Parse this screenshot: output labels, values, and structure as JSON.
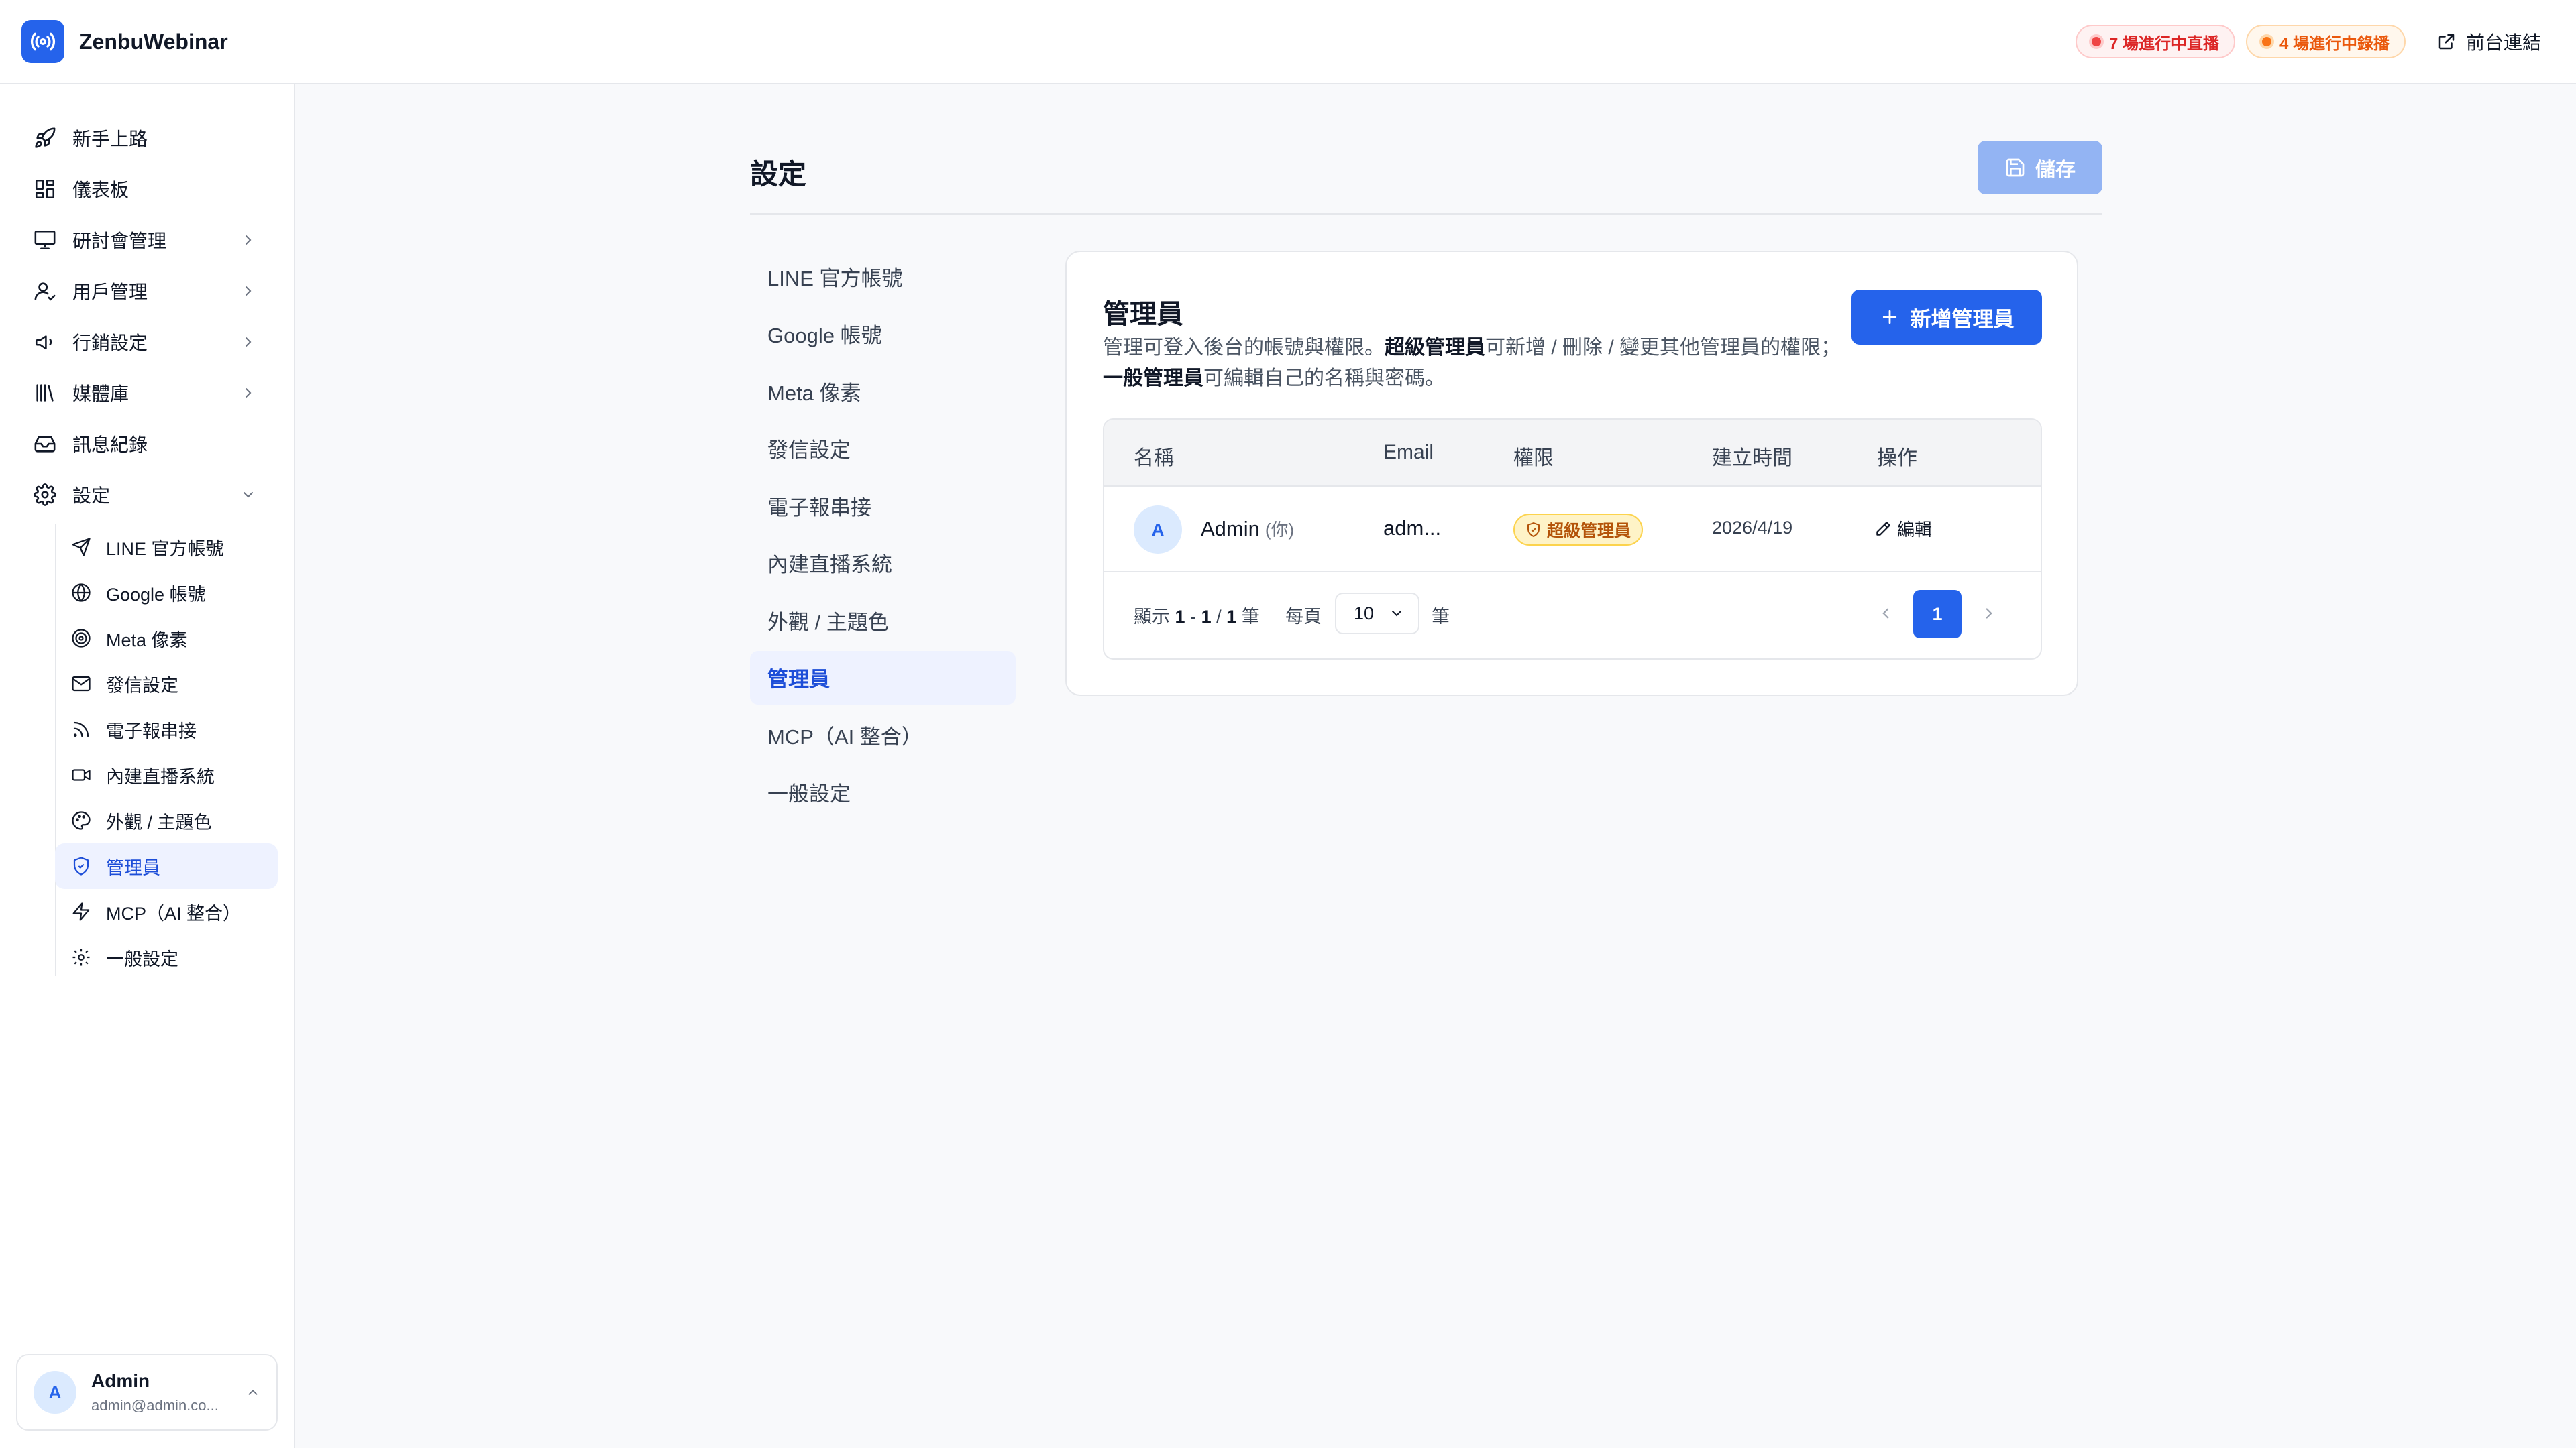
{
  "header": {
    "app_name": "ZenbuWebinar",
    "live_badge": "7 場進行中直播",
    "recording_badge": "4 場進行中錄播",
    "front_link": "前台連結"
  },
  "sidebar": {
    "items": [
      {
        "label": "新手上路",
        "icon": "rocket-icon"
      },
      {
        "label": "儀表板",
        "icon": "dashboard-icon"
      },
      {
        "label": "研討會管理",
        "icon": "presentation-icon"
      },
      {
        "label": "用戶管理",
        "icon": "users-icon"
      },
      {
        "label": "行銷設定",
        "icon": "megaphone-icon"
      },
      {
        "label": "媒體庫",
        "icon": "library-icon"
      },
      {
        "label": "訊息紀錄",
        "icon": "inbox-icon"
      },
      {
        "label": "設定",
        "icon": "gear-icon"
      }
    ],
    "sub_items": [
      {
        "label": "LINE 官方帳號",
        "icon": "send-icon"
      },
      {
        "label": "Google 帳號",
        "icon": "globe-icon"
      },
      {
        "label": "Meta 像素",
        "icon": "target-icon"
      },
      {
        "label": "發信設定",
        "icon": "mail-icon"
      },
      {
        "label": "電子報串接",
        "icon": "rss-icon"
      },
      {
        "label": "內建直播系統",
        "icon": "video-icon"
      },
      {
        "label": "外觀 / 主題色",
        "icon": "palette-icon"
      },
      {
        "label": "管理員",
        "icon": "shield-icon"
      },
      {
        "label": "MCP（AI 整合）",
        "icon": "zap-icon"
      },
      {
        "label": "一般設定",
        "icon": "cog-icon"
      }
    ],
    "user": {
      "avatar": "A",
      "name": "Admin",
      "email": "admin@admin.co..."
    }
  },
  "main": {
    "title": "設定",
    "save_label": "儲存",
    "settings_nav": [
      "LINE 官方帳號",
      "Google 帳號",
      "Meta 像素",
      "發信設定",
      "電子報串接",
      "內建直播系統",
      "外觀 / 主題色",
      "管理員",
      "MCP（AI 整合）",
      "一般設定"
    ],
    "active_setting": "管理員"
  },
  "card": {
    "title": "管理員",
    "desc_1": "管理可登入後台的帳號與權限。",
    "desc_bold_1": "超級管理員",
    "desc_2": "可新增 / 刪除 / 變更其他管理員的權限；",
    "desc_bold_2": "一般管理員",
    "desc_3": "可編輯自己的名稱與密碼。",
    "add_button": "新增管理員",
    "table": {
      "headers": [
        "名稱",
        "Email",
        "權限",
        "建立時間",
        "操作"
      ],
      "rows": [
        {
          "avatar": "A",
          "name": "Admin",
          "you_tag": "(你)",
          "email": "adm...",
          "role": "超級管理員",
          "created": "2026/4/19",
          "action": "編輯"
        }
      ]
    },
    "pagination": {
      "prefix": "顯示",
      "from": "1",
      "dash": "-",
      "to": "1",
      "slash": "/",
      "total": "1",
      "unit": "筆",
      "per_page_label": "每頁",
      "page_size": "10",
      "per_page_unit": "筆",
      "current_page": "1"
    }
  },
  "colors": {
    "primary": "#2563eb",
    "live": "#dc2626",
    "recording": "#ea580c",
    "badge_super_admin": "#b45309"
  }
}
